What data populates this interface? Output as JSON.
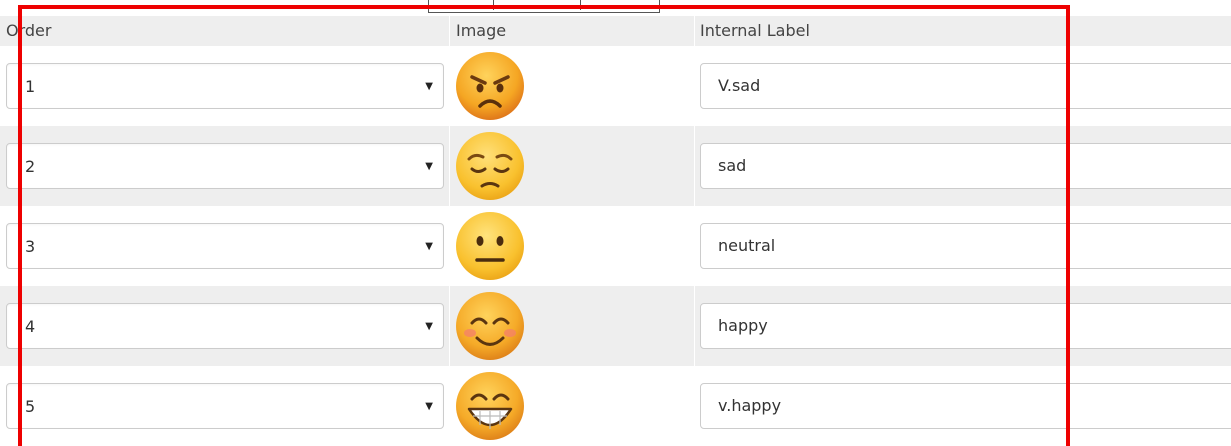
{
  "table": {
    "headers": {
      "order": "Order",
      "image": "Image",
      "label": "Internal Label"
    },
    "rows": [
      {
        "order": "1",
        "emoji": "angry-face-icon",
        "label": "V.sad"
      },
      {
        "order": "2",
        "emoji": "pensive-face-icon",
        "label": "sad"
      },
      {
        "order": "3",
        "emoji": "neutral-face-icon",
        "label": "neutral"
      },
      {
        "order": "4",
        "emoji": "smiling-blush-face-icon",
        "label": "happy"
      },
      {
        "order": "5",
        "emoji": "grinning-face-icon",
        "label": "v.happy"
      }
    ]
  },
  "colors": {
    "highlight": "#ee0000",
    "row_alt": "#eeeeee",
    "emoji_face": "#f7b518"
  }
}
